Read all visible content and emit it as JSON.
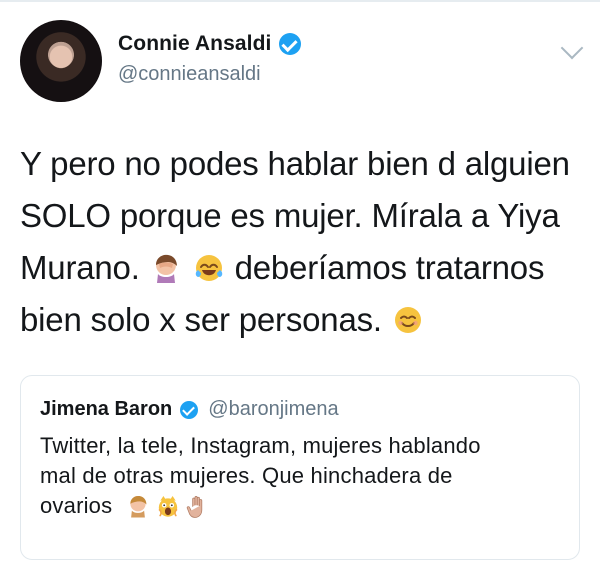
{
  "tweet": {
    "author": {
      "display_name": "Connie Ansaldi",
      "handle": "@connieansaldi",
      "verified": true
    },
    "text_lines": [
      "Y pero no podes hablar bien d alguien",
      "SOLO porque es mujer. Mírala a Yiya",
      "Murano.",
      "deberíamos tratarnos",
      "bien solo x ser personas."
    ],
    "emojis_line3": [
      "facepalm-icon",
      "tears-of-joy-icon"
    ],
    "emoji_line5": "smiling-face-icon"
  },
  "quoted_tweet": {
    "author": {
      "display_name": "Jimena Baron",
      "handle": "@baronjimena",
      "verified": true
    },
    "text_lines": [
      "Twitter, la tele, Instagram, mujeres hablando",
      "mal de otras mujeres. Que hinchadera de",
      "ovarios"
    ],
    "emojis": [
      "facepalm-icon",
      "screaming-cat-icon",
      "raised-hand-icon"
    ]
  },
  "colors": {
    "text_primary": "#14171a",
    "text_secondary": "#657786",
    "verified_blue": "#1da1f2",
    "border": "#e1e8ed",
    "divider": "#e6ecf0"
  }
}
